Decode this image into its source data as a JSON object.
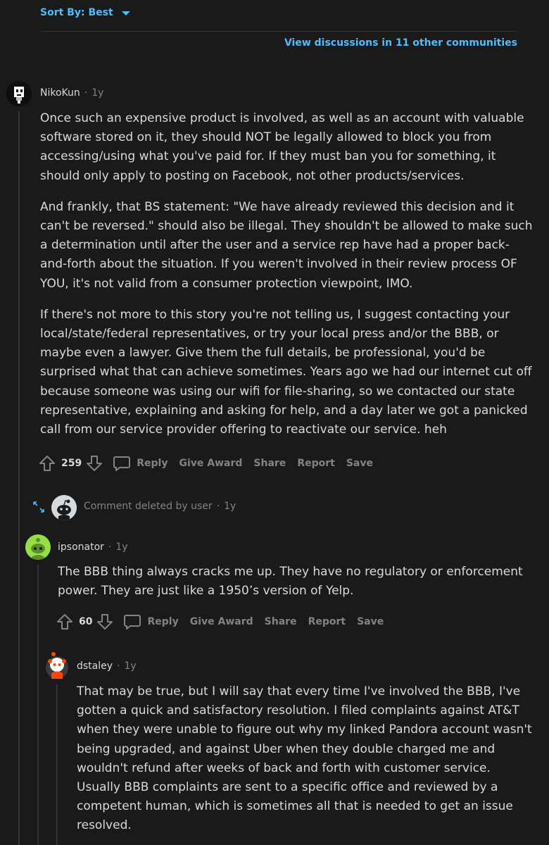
{
  "sort": {
    "label": "Sort By: Best"
  },
  "view_other": "View discussions in 11 other communities",
  "comments": [
    {
      "username": "NikoKun",
      "age": "1y",
      "paragraphs": [
        "Once such an expensive product is involved, as well as an account with valuable software stored on it, they should NOT be legally allowed to block you from accessing/using what you've paid for. If they must ban you for something, it should only apply to posting on Facebook, not other products/services.",
        "And frankly, that BS statement: \"We have already reviewed this decision and it can't be reversed.\" should also be illegal. They shouldn't be allowed to make such a determination until after the user and a service rep have had a proper back-and-forth about the situation. If you weren't involved in their review process OF YOU, it's not valid from a consumer protection viewpoint, IMO.",
        "If there's not more to this story you're not telling us, I suggest contacting your local/state/federal representatives, or try your local press and/or the BBB, or maybe even a lawyer. Give them the full details, be professional, you'd be surprised what that can achieve sometimes. Years ago we had our internet cut off because someone was using our wifi for file-sharing, so we contacted our state representative, explaining and asking for help, and a day later we got a panicked call from our service provider offering to reactivate our service. heh"
      ],
      "score": "259"
    },
    {
      "deleted_label": "Comment deleted by user",
      "age": "1y"
    },
    {
      "username": "ipsonator",
      "age": "1y",
      "paragraphs": [
        "The BBB thing always cracks me up. They have no regulatory or enforcement power. They are just like a 1950’s version of Yelp."
      ],
      "score": "60"
    },
    {
      "username": "dstaley",
      "age": "1y",
      "paragraphs": [
        "That may be true, but I will say that every time I've involved the BBB, I've gotten a quick and satisfactory resolution. I filed complaints against AT&T when they were unable to figure out why my linked Pandora account wasn't being upgraded, and against Uber when they double charged me and wouldn't refund after weeks of back and forth with customer service. Usually BBB complaints are sent to a specific office and reviewed by a competent human, which is sometimes all that is needed to get an issue resolved."
      ]
    }
  ],
  "actions": {
    "reply": "Reply",
    "give_award": "Give Award",
    "share": "Share",
    "report": "Report",
    "save": "Save"
  },
  "icons": {
    "upvote": "upvote-arrow-icon",
    "downvote": "downvote-arrow-icon",
    "reply": "speech-bubble-icon",
    "expand": "expand-arrows-icon",
    "sort_caret": "caret-down-icon"
  },
  "colors": {
    "background": "#1a1a1b",
    "text": "#d7dadc",
    "muted": "#818384",
    "link": "#4fbcff",
    "thread_line": "#343536"
  }
}
